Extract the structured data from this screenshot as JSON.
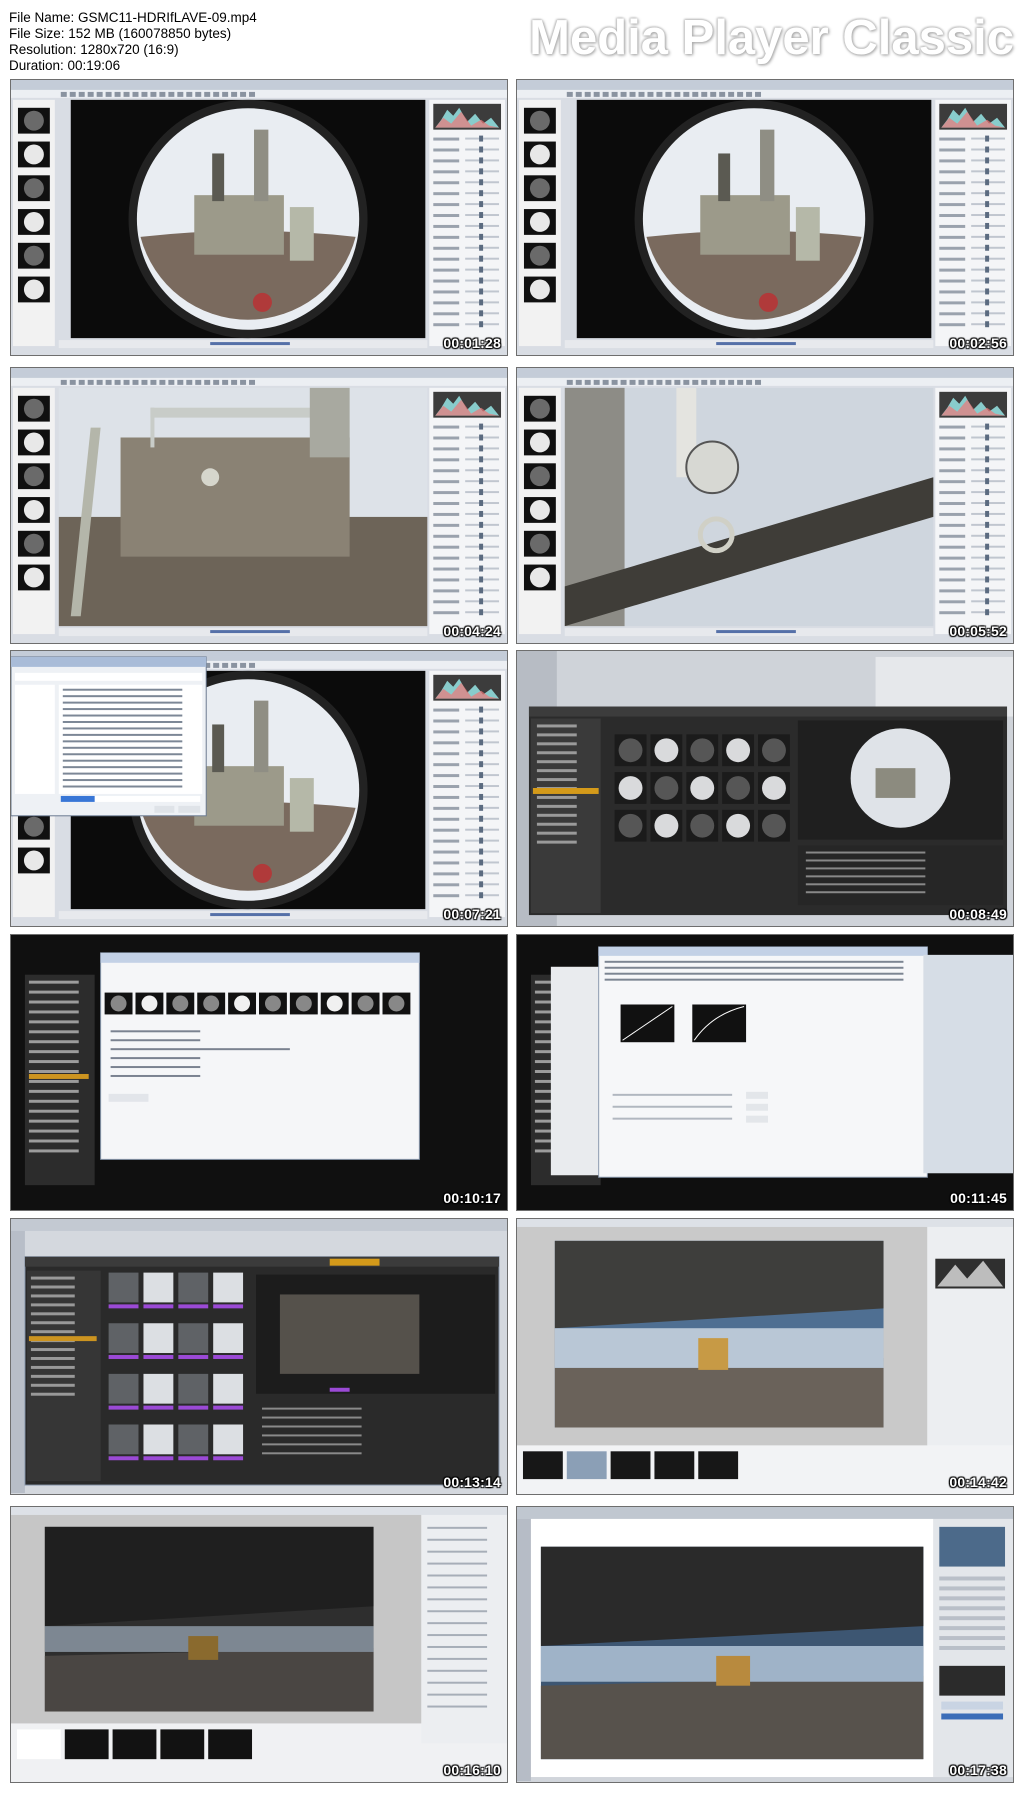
{
  "file_info": {
    "name_line": "File Name: GSMC11-HDRIfLAVE-09.mp4",
    "size_line": "File Size: 152 MB (160078850 bytes)",
    "resolution_line": "Resolution: 1280x720 (16:9)",
    "duration_line": "Duration: 00:19:06"
  },
  "brand": "Media Player Classic",
  "frames": [
    {
      "timestamp": "00:01:28",
      "scene": "fisheye-raw",
      "bg": "light"
    },
    {
      "timestamp": "00:02:56",
      "scene": "fisheye-raw",
      "bg": "light"
    },
    {
      "timestamp": "00:04:24",
      "scene": "closeup-machine",
      "bg": "light"
    },
    {
      "timestamp": "00:05:52",
      "scene": "gauge-closeup",
      "bg": "light"
    },
    {
      "timestamp": "00:07:21",
      "scene": "save-dialog",
      "bg": "light"
    },
    {
      "timestamp": "00:08:49",
      "scene": "bridge-dark",
      "bg": "dark"
    },
    {
      "timestamp": "00:10:17",
      "scene": "batch-dialog",
      "bg": "dark"
    },
    {
      "timestamp": "00:11:45",
      "scene": "settings-dialog",
      "bg": "dark"
    },
    {
      "timestamp": "00:13:14",
      "scene": "bridge-grid",
      "bg": "light"
    },
    {
      "timestamp": "00:14:42",
      "scene": "panorama-bright",
      "bg": "light"
    },
    {
      "timestamp": "00:16:10",
      "scene": "panorama-dark",
      "bg": "light"
    },
    {
      "timestamp": "00:17:38",
      "scene": "panorama-final",
      "bg": "light"
    }
  ]
}
